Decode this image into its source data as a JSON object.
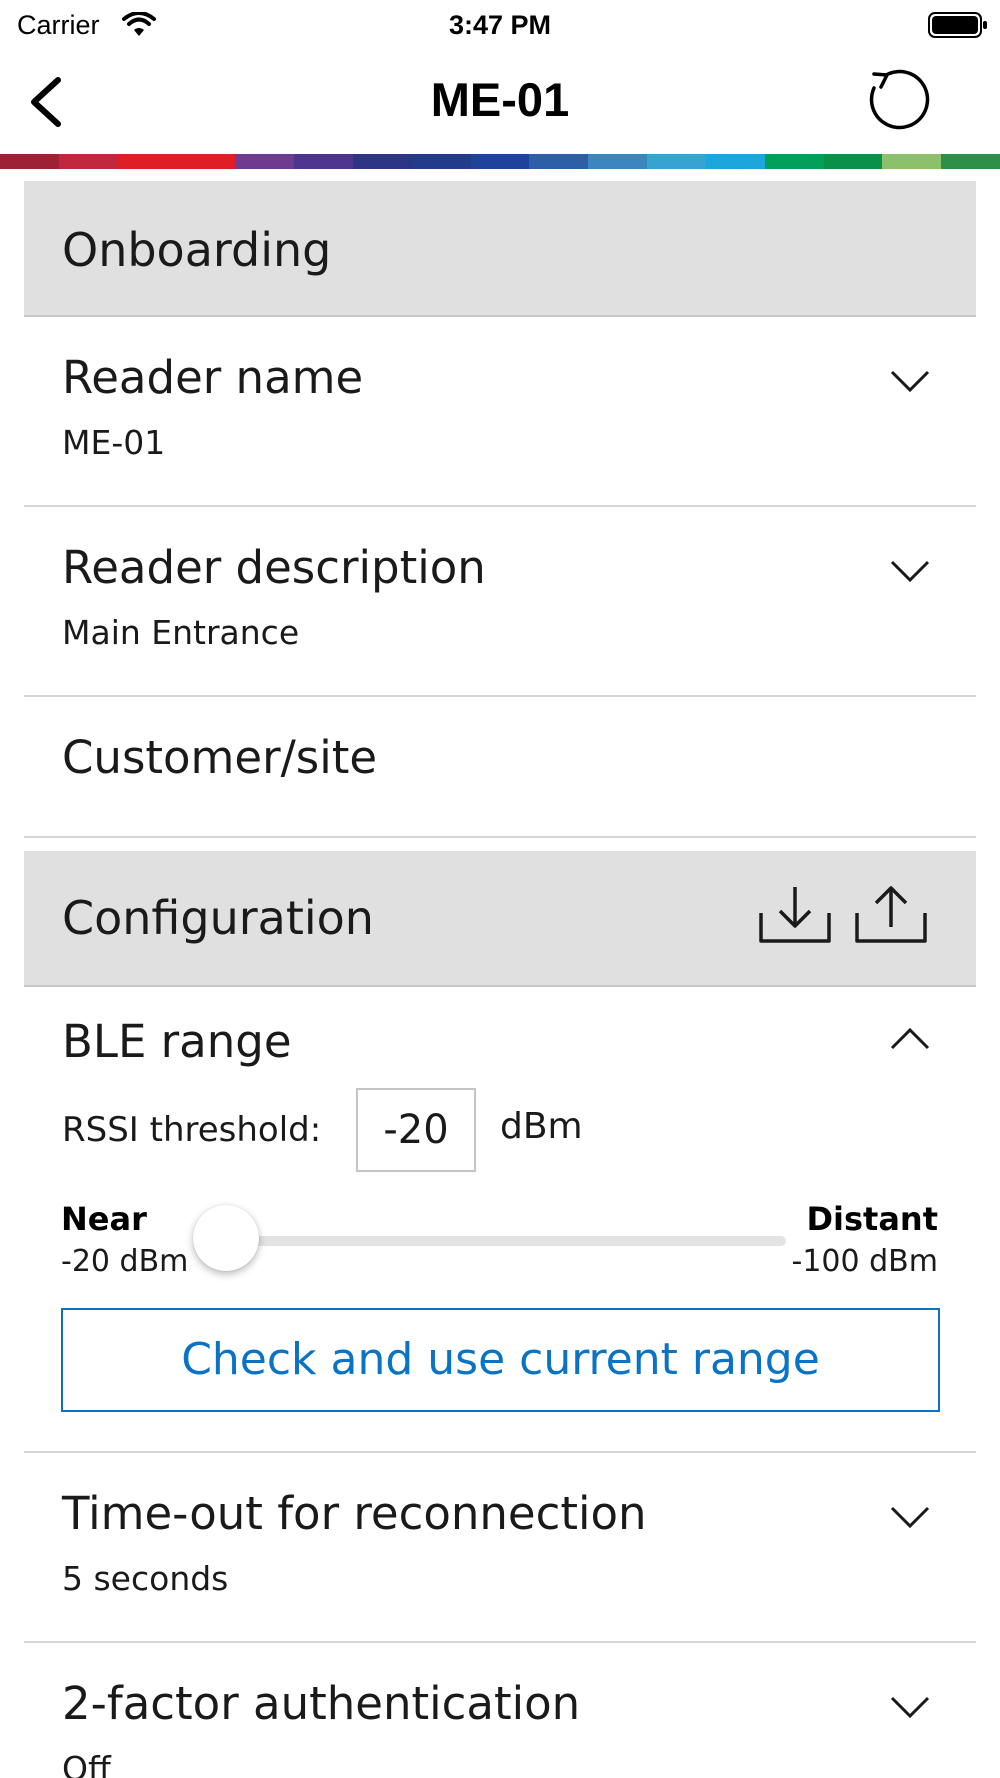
{
  "status_bar": {
    "carrier": "Carrier",
    "time": "3:47 PM"
  },
  "nav": {
    "title": "ME-01",
    "back_icon": "chevron-left-icon",
    "refresh_icon": "refresh-icon"
  },
  "supergraphic_colors": [
    "#9e2236",
    "#c1283e",
    "#e01e26",
    "#e01e26",
    "#6f3b91",
    "#4e3590",
    "#2d3585",
    "#233b8b",
    "#1f4398",
    "#2d5fa6",
    "#3a86bd",
    "#37a3d3",
    "#1ba7dc",
    "#00a05b",
    "#0b9147",
    "#8cc06a",
    "#2e8f49"
  ],
  "onboarding": {
    "header": "Onboarding",
    "rows": [
      {
        "title": "Reader name",
        "value": "ME-01"
      },
      {
        "title": "Reader description",
        "value": "Main Entrance"
      },
      {
        "title": "Customer/site",
        "value": ""
      }
    ]
  },
  "configuration": {
    "header": "Configuration",
    "download_icon": "download-icon",
    "upload_icon": "upload-icon",
    "ble_range": {
      "title": "BLE range",
      "rssi_label": "RSSI threshold:",
      "rssi_value": "-20",
      "rssi_unit": "dBm",
      "near_title": "Near",
      "near_value": "-20 dBm",
      "distant_title": "Distant",
      "distant_value": "-100 dBm",
      "slider_position_fraction": 0,
      "check_button": "Check and use current range"
    },
    "rows": [
      {
        "title": "Time-out for reconnection",
        "value": "5 seconds"
      },
      {
        "title": "2-factor authentication",
        "value": "Off"
      }
    ]
  },
  "colors": {
    "accent": "#0b73c4",
    "section_bg": "#e0e0e0",
    "divider": "#d5d5d5"
  }
}
